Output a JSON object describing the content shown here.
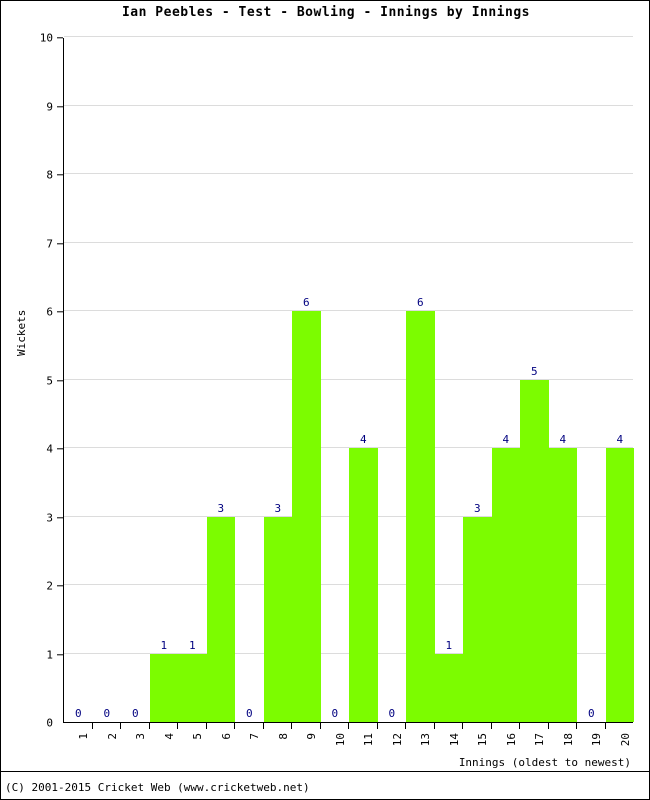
{
  "chart_data": {
    "type": "bar",
    "title": "Ian Peebles - Test - Bowling - Innings by Innings",
    "xlabel": "Innings (oldest to newest)",
    "ylabel": "Wickets",
    "categories": [
      "1",
      "2",
      "3",
      "4",
      "5",
      "6",
      "7",
      "8",
      "9",
      "10",
      "11",
      "12",
      "13",
      "14",
      "15",
      "16",
      "17",
      "18",
      "19",
      "20"
    ],
    "values": [
      0,
      0,
      0,
      1,
      1,
      3,
      0,
      3,
      6,
      0,
      4,
      0,
      6,
      1,
      3,
      4,
      5,
      4,
      0,
      4
    ],
    "ylim": [
      0,
      10
    ],
    "y_ticks": [
      0,
      1,
      2,
      3,
      4,
      5,
      6,
      7,
      8,
      9,
      10
    ],
    "grid": true,
    "legend": "none",
    "bar_color": "#7CFC00",
    "label_color": "#000080",
    "axis_color": "#000000",
    "grid_color": "#DCDCDC",
    "data_labels_shown": true
  },
  "footer": {
    "copyright": "(C) 2001-2015 Cricket Web (www.cricketweb.net)"
  }
}
